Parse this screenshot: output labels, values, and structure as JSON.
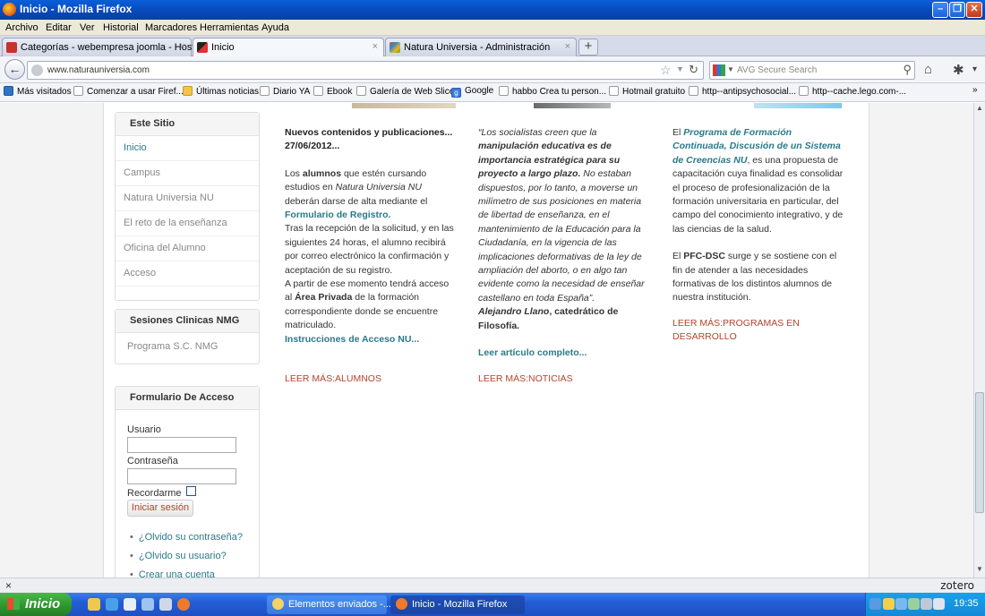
{
  "window": {
    "title": "Inicio - Mozilla Firefox"
  },
  "menu": [
    "Archivo",
    "Editar",
    "Ver",
    "Historial",
    "Marcadores",
    "Herramientas",
    "Ayuda"
  ],
  "tabs": [
    {
      "label": "Categorías - webempresa joomla - Hostin...",
      "close": "×"
    },
    {
      "label": "Inicio",
      "close": "×"
    },
    {
      "label": "Natura Universia - Administración",
      "close": "×"
    }
  ],
  "new_tab": "+",
  "nav": {
    "url": "www.naturauniversia.com",
    "search_placeholder": "AVG Secure Search"
  },
  "bookmarks": [
    "Más visitados",
    "Comenzar a usar Firef...",
    "Últimas noticias",
    "Diario YA",
    "Ebook",
    "Galería de Web Slice",
    "Google",
    "habbo Crea tu person...",
    "Hotmail gratuito",
    "http--antipsychosocial...",
    "http--cache.lego.com-..."
  ],
  "sidebar": {
    "site_module": {
      "title": "Este Sitio",
      "items": [
        "Inicio",
        "Campus",
        "Natura Universia NU",
        "El reto de la enseñanza",
        "Oficina del Alumno",
        "Acceso"
      ]
    },
    "clinical_module": {
      "title": "Sesiones Clinicas NMG",
      "items": [
        "Programa S.C. NMG"
      ]
    },
    "login_module": {
      "title": "Formulario De Acceso",
      "username_label": "Usuario",
      "password_label": "Contraseña",
      "remember_label": "Recordarme",
      "submit_label": "Iniciar sesión",
      "links": [
        "¿Olvido su contraseña?",
        "¿Olvido su usuario?",
        "Crear una cuenta"
      ]
    }
  },
  "col1": {
    "heading_a": "Nuevos contenidos y publicaciones...",
    "heading_b": "27/06/2012...",
    "p1_a": "Los ",
    "p1_b": "alumnos",
    "p1_c": " que estén cursando estudios en ",
    "p1_d": "Natura Universia NU",
    "p1_e": " deberán darse de alta mediante el ",
    "p1_link": "Formulario de Registro.",
    "p2": "Tras la recepción de la solicitud, y en las siguientes 24 horas, el alumno recibirá por correo electrónico la confirmación y aceptación de su registro.",
    "p3_a": "A partir de ese momento tendrá acceso al ",
    "p3_b": "Área Privada",
    "p3_c": " de la formación correspondiente donde se encuentre matriculado.",
    "link": "Instrucciones de Acceso NU...",
    "readmore": "LEER MÁS:ALUMNOS"
  },
  "col2": {
    "q_a": "“Los socialistas creen que la ",
    "q_b": "manipulación educativa es de importancia estratégica para su proyecto a largo plazo.",
    "q_c": " No estaban dispuestos, por lo tanto, a moverse un milímetro de sus posiciones en materia de libertad de enseñanza, en el mantenimiento de la Educación para la Ciudadanía, en la vigencia de las implicaciones deformativas de la ley de ampliación del aborto, o en algo tan evidente como la necesidad de enseñar castellano en toda España",
    "q_d": "”.",
    "author_a": "Alejandro Llano",
    "author_b": ", catedrático de Filosofía.",
    "link": "Leer artículo completo...",
    "readmore": "LEER MÁS:NOTICIAS"
  },
  "col3": {
    "p1_a": "El ",
    "p1_link": "Programa de Formación Continuada, Discusión de un Sistema de Creencias NU",
    "p1_b": ", es una propuesta de capacitación cuya finalidad es consolidar el proceso de profesionalización de la formación universitaria en particular, del campo del conocimiento integrativo, y de las ciencias de la salud.",
    "p2_a": "El ",
    "p2_b": "PFC-DSC",
    "p2_c": " surge y se sostiene con el fin de atender a las necesidades formativas de los distintos alumnos de nuestra institución.",
    "readmore": "LEER MÁS:PROGRAMAS EN DESARROLLO"
  },
  "addon_bar": {
    "close": "×",
    "zotero": "zotero"
  },
  "taskbar": {
    "start": "Inicio",
    "tasks": [
      "Elementos enviados -...",
      "Inicio - Mozilla Firefox"
    ],
    "clock": "19:35"
  }
}
